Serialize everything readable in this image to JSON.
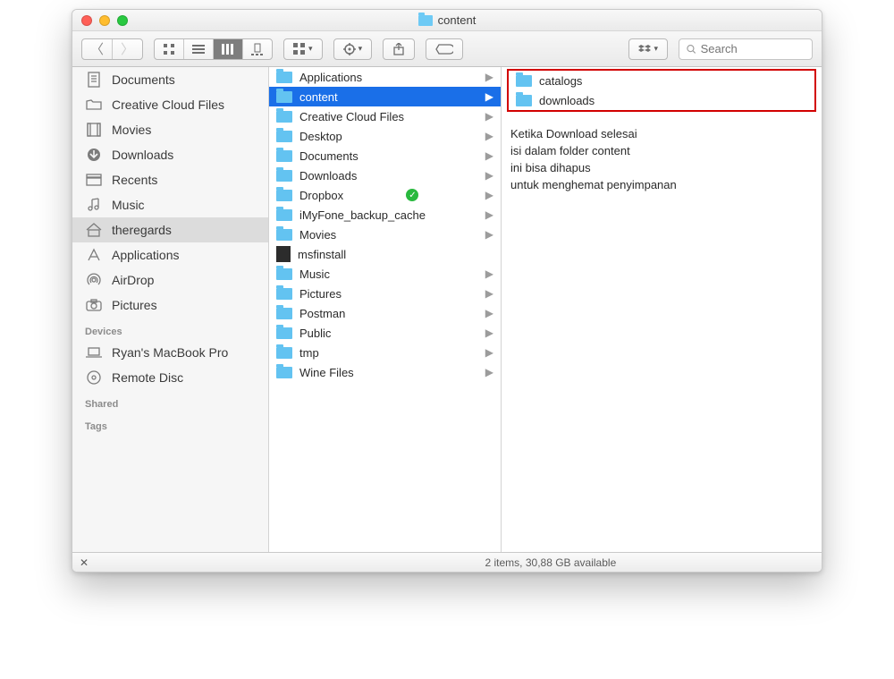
{
  "window": {
    "title": "content"
  },
  "toolbar": {
    "search_placeholder": "Search"
  },
  "sidebar": {
    "favorites": [
      {
        "label": "Documents",
        "icon": "doc"
      },
      {
        "label": "Creative Cloud Files",
        "icon": "folder"
      },
      {
        "label": "Movies",
        "icon": "film"
      },
      {
        "label": "Downloads",
        "icon": "download"
      },
      {
        "label": "Recents",
        "icon": "recent"
      },
      {
        "label": "Music",
        "icon": "music"
      },
      {
        "label": "theregards",
        "icon": "home",
        "selected": true
      },
      {
        "label": "Applications",
        "icon": "apps"
      },
      {
        "label": "AirDrop",
        "icon": "airdrop"
      },
      {
        "label": "Pictures",
        "icon": "camera"
      }
    ],
    "devices_header": "Devices",
    "devices": [
      {
        "label": "Ryan's MacBook Pro",
        "icon": "laptop"
      },
      {
        "label": "Remote Disc",
        "icon": "disc"
      }
    ],
    "shared_header": "Shared",
    "tags_header": "Tags"
  },
  "column1": [
    {
      "name": "Applications",
      "type": "folder",
      "hasChildren": true
    },
    {
      "name": "content",
      "type": "folder",
      "hasChildren": true,
      "selected": true
    },
    {
      "name": "Creative Cloud Files",
      "type": "folder",
      "hasChildren": true
    },
    {
      "name": "Desktop",
      "type": "folder",
      "hasChildren": true
    },
    {
      "name": "Documents",
      "type": "folder",
      "hasChildren": true
    },
    {
      "name": "Downloads",
      "type": "folder",
      "hasChildren": true
    },
    {
      "name": "Dropbox",
      "type": "folder",
      "hasChildren": true,
      "synced": true
    },
    {
      "name": "iMyFone_backup_cache",
      "type": "folder",
      "hasChildren": true
    },
    {
      "name": "Movies",
      "type": "folder",
      "hasChildren": true
    },
    {
      "name": "msfinstall",
      "type": "file"
    },
    {
      "name": "Music",
      "type": "folder",
      "hasChildren": true
    },
    {
      "name": "Pictures",
      "type": "folder",
      "hasChildren": true
    },
    {
      "name": "Postman",
      "type": "folder",
      "hasChildren": true
    },
    {
      "name": "Public",
      "type": "folder",
      "hasChildren": true
    },
    {
      "name": "tmp",
      "type": "folder",
      "hasChildren": true
    },
    {
      "name": "Wine Files",
      "type": "folder",
      "hasChildren": true
    }
  ],
  "column2": [
    {
      "name": "catalogs",
      "type": "folder"
    },
    {
      "name": "downloads",
      "type": "folder"
    }
  ],
  "annotation": "Ketika Download selesai\nisi dalam folder content\nini bisa dihapus\nuntuk menghemat penyimpanan",
  "status": {
    "text": "2 items, 30,88 GB available"
  }
}
